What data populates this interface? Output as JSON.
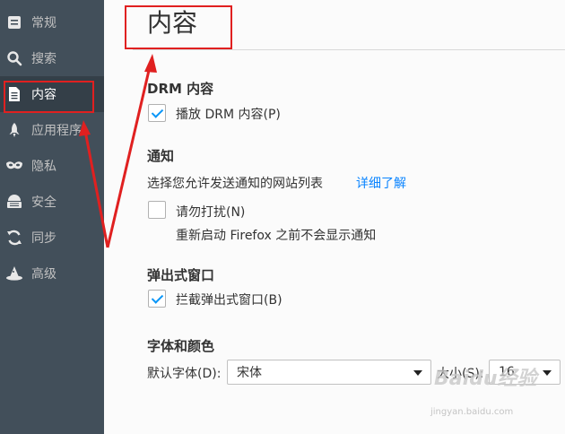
{
  "sidebar": {
    "items": [
      {
        "label": "常规",
        "icon": "general-icon"
      },
      {
        "label": "搜索",
        "icon": "search-icon"
      },
      {
        "label": "内容",
        "icon": "content-document-icon",
        "selected": true
      },
      {
        "label": "应用程序",
        "icon": "applications-rocket-icon"
      },
      {
        "label": "隐私",
        "icon": "privacy-mask-icon"
      },
      {
        "label": "安全",
        "icon": "security-icon"
      },
      {
        "label": "同步",
        "icon": "sync-icon"
      },
      {
        "label": "高级",
        "icon": "advanced-wizard-hat-icon"
      }
    ]
  },
  "page": {
    "title": "内容"
  },
  "drm": {
    "heading": "DRM 内容",
    "play_label": "播放 DRM 内容(P)",
    "play_checked": true
  },
  "notifications": {
    "heading": "通知",
    "description": "选择您允许发送通知的网站列表",
    "learn_more": "详细了解",
    "dnd_label": "请勿打扰(N)",
    "dnd_checked": false,
    "dnd_note": "重新启动 Firefox 之前不会显示通知"
  },
  "popups": {
    "heading": "弹出式窗口",
    "block_label": "拦截弹出式窗口(B)",
    "block_checked": true
  },
  "fonts": {
    "heading": "字体和颜色",
    "default_font_label": "默认字体(D):",
    "default_font_value": "宋体",
    "size_label": "大小(S):",
    "size_value": "16"
  },
  "watermark": {
    "text": "Baidu经验",
    "sub": "jingyan.baidu.com"
  },
  "colors": {
    "sidebar_bg": "#424f5a",
    "sidebar_selected_bg": "#343f48",
    "annotation_red": "#e02020",
    "link_blue": "#0a84ff",
    "check_blue": "#0996f8"
  }
}
